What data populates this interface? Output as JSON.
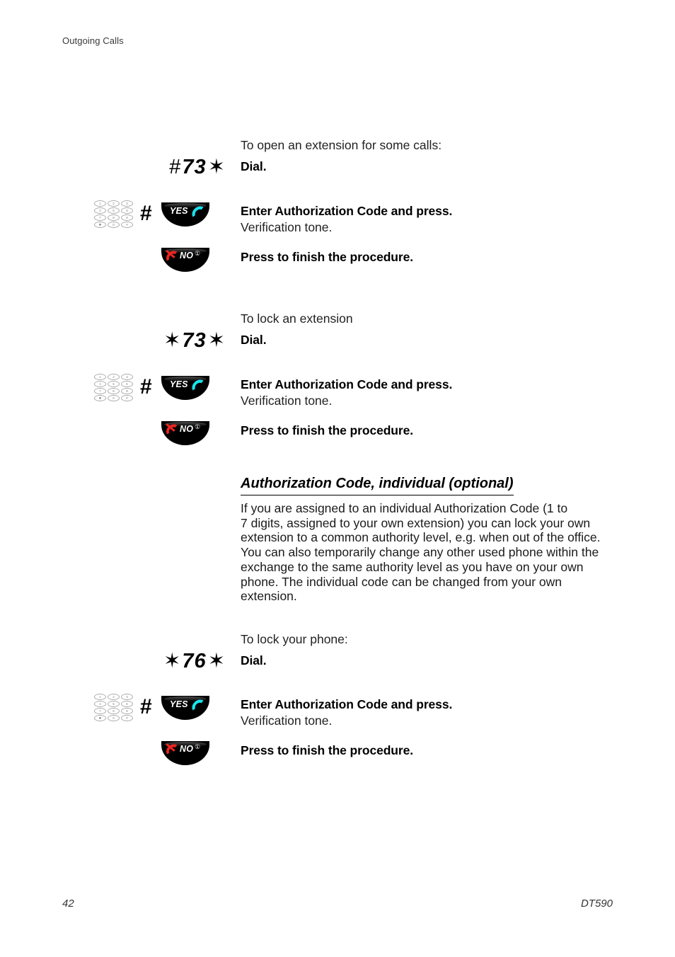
{
  "header": {
    "running_head": "Outgoing Calls"
  },
  "blocks": [
    {
      "lead_in": "To open an extension for some calls:",
      "dial": {
        "prefix": "#",
        "digits": "73",
        "suffix": "✶"
      },
      "dial_label": "Dial.",
      "enter_label": "Enter Authorization Code and press.",
      "enter_sub": "Verification tone.",
      "finish_label": "Press to finish the procedure."
    },
    {
      "lead_in": "To lock an extension",
      "dial": {
        "prefix": "✶",
        "digits": "73",
        "suffix": "✶"
      },
      "dial_label": "Dial.",
      "enter_label": "Enter Authorization Code and press.",
      "enter_sub": "Verification tone.",
      "finish_label": "Press to finish the procedure."
    },
    {
      "lead_in": "To lock your phone:",
      "dial": {
        "prefix": "✶",
        "digits": "76",
        "suffix": "✶"
      },
      "dial_label": "Dial.",
      "enter_label": "Enter Authorization Code and press.",
      "enter_sub": "Verification tone.",
      "finish_label": "Press to finish the procedure."
    }
  ],
  "section": {
    "heading": "Authorization Code, individual (optional)",
    "paragraph_lines": [
      "If you are assigned to an individual Authorization Code (1 to",
      "7 digits, assigned to your own extension) you can lock your own",
      "extension to a common authority level, e.g. when out of the office.",
      "You can also temporarily change any other used phone within the",
      "exchange to the same authority level as you have on your own",
      "phone. The individual code can be changed from your own",
      "extension."
    ]
  },
  "keypad": {
    "keys": [
      "1",
      "2",
      "3",
      "4",
      "5",
      "6",
      "7",
      "8",
      "9",
      "✱",
      "0",
      "#"
    ]
  },
  "softkeys": {
    "yes_label": "YES",
    "no_label": "NO",
    "no_superscript": "①",
    "hash_glyph": "#"
  },
  "footer": {
    "page_number": "42",
    "model": "DT590"
  },
  "colors": {
    "handset_yes": "#17E3EE",
    "handset_no": "#E8251F",
    "key_black": "#000000",
    "text": "#1a1a1a"
  }
}
